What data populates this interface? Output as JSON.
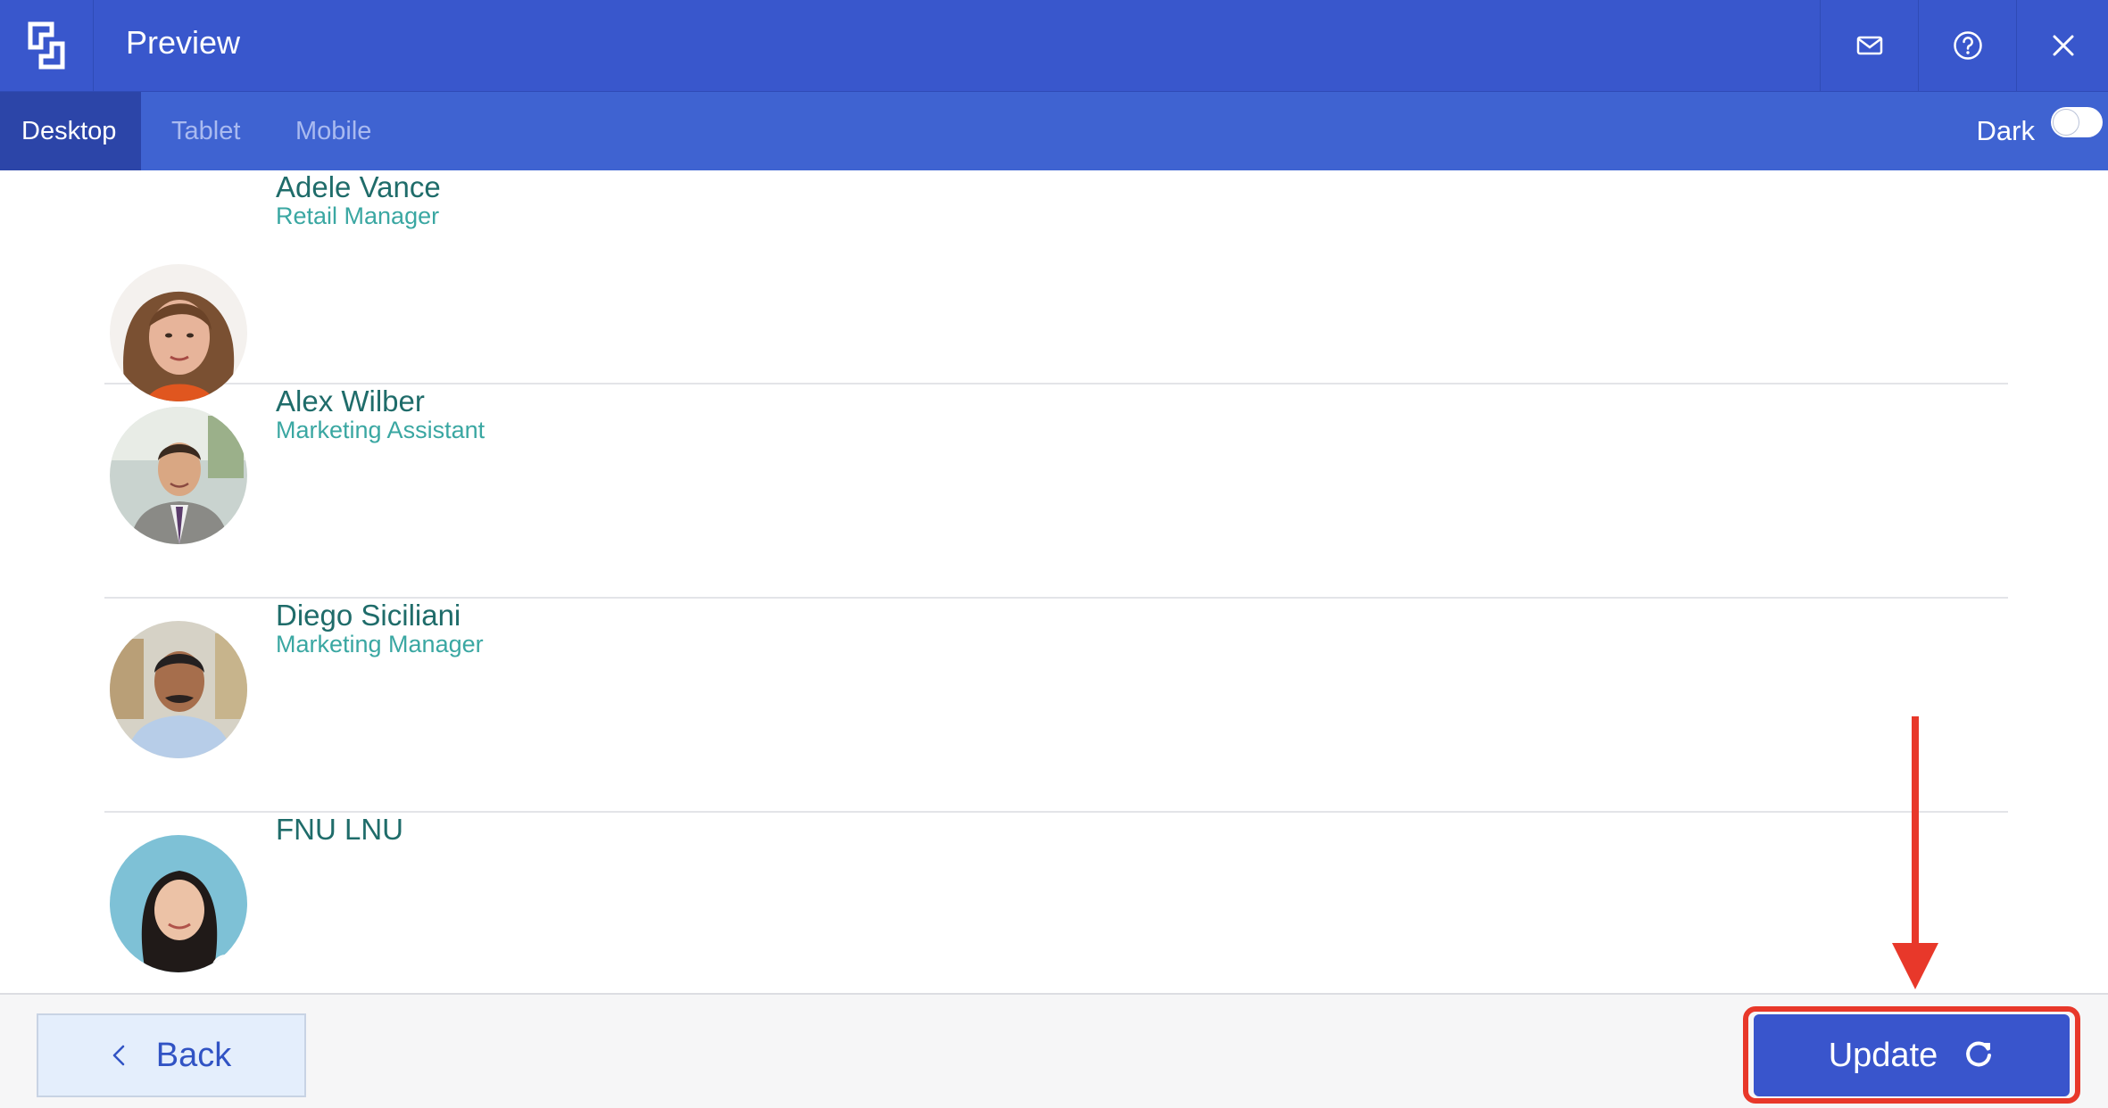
{
  "header": {
    "title": "Preview",
    "logo_icon": "bracket-logo-icon",
    "mail_icon": "mail-icon",
    "help_icon": "help-icon",
    "close_icon": "close-icon"
  },
  "tabs": [
    {
      "label": "Desktop",
      "active": true
    },
    {
      "label": "Tablet",
      "active": false
    },
    {
      "label": "Mobile",
      "active": false
    }
  ],
  "dark_mode": {
    "label": "Dark",
    "enabled": false
  },
  "people": [
    {
      "name": "Adele Vance",
      "role": "Retail Manager"
    },
    {
      "name": "Alex Wilber",
      "role": "Marketing Assistant"
    },
    {
      "name": "Diego Siciliani",
      "role": "Marketing Manager"
    },
    {
      "name": "FNU LNU",
      "role": ""
    }
  ],
  "footer": {
    "back_label": "Back",
    "back_icon": "chevron-left-icon",
    "update_label": "Update",
    "update_icon": "refresh-icon"
  },
  "colors": {
    "header_bg": "#3957cc",
    "tab_bar_bg": "#3f63d1",
    "active_tab_bg": "#2c45a8",
    "name_text": "#1f6c6a",
    "role_text": "#3aa7a2",
    "highlight": "#e8382a"
  }
}
